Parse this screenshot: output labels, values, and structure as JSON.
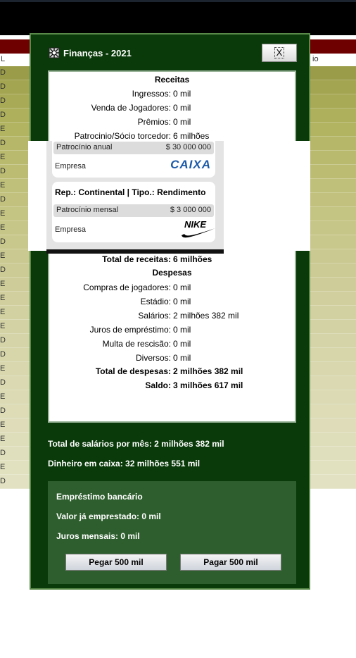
{
  "background": {
    "subheader": {
      "left": "L",
      "right": "io"
    },
    "row_markers": [
      "D",
      "D",
      "D",
      "D",
      "E",
      "D",
      "E",
      "D",
      "E",
      "D",
      "E",
      "E",
      "D",
      "E",
      "D",
      "E",
      "E",
      "E",
      "E",
      "D",
      "D",
      "E",
      "D",
      "E",
      "D",
      "E",
      "E",
      "D",
      "E",
      "D",
      "D",
      "E"
    ],
    "row_colors": [
      "#9a9c4a",
      "#a3a550",
      "#a9aa56",
      "#aeb05c",
      "#b2b462",
      "#b6b768",
      "#b9ba6e",
      "#bcbd73",
      "#bfc079",
      "#c2c27e",
      "#c4c483",
      "#c6c688",
      "#c8c88c",
      "#cac991",
      "#cccb95",
      "#cecd99",
      "#d0cf9d",
      "#d2d1a1",
      "#d3d2a5",
      "#d5d4a8",
      "#d7d6ab",
      "#d8d7ae",
      "#dad9b1",
      "#dbdab4",
      "#dddcb7",
      "#dedcb9",
      "#dfdebb",
      "#e0dfbd",
      "#e1e0bf",
      "#e2e1c1"
    ]
  },
  "dialog": {
    "title": "Finanças - 2021",
    "close_label": "X",
    "receitas_title": "Receitas",
    "receitas": [
      {
        "label": "Ingressos:",
        "value": "0 mil"
      },
      {
        "label": "Venda de Jogadores:",
        "value": "0 mil"
      },
      {
        "label": "Prêmios:",
        "value": "0 mil"
      },
      {
        "label": "Patrocinio/Sócio torcedor:",
        "value": "6 milhões"
      }
    ],
    "total_receitas": {
      "label": "Total de receitas:",
      "value": "6 milhões"
    },
    "despesas_title": "Despesas",
    "despesas": [
      {
        "label": "Compras de jogadores:",
        "value": "0 mil"
      },
      {
        "label": "Estádio:",
        "value": "0 mil"
      },
      {
        "label": "Salários:",
        "value": "2 milhões 382 mil"
      },
      {
        "label": "Juros de empréstimo:",
        "value": "0 mil"
      },
      {
        "label": "Multa de rescisão:",
        "value": "0 mil"
      },
      {
        "label": "Diversos:",
        "value": "0 mil"
      }
    ],
    "total_despesas": {
      "label": "Total de despesas:",
      "value": "2 milhões 382 mil"
    },
    "saldo": {
      "label": "Saldo:",
      "value": "3 milhões 617 mil"
    },
    "total_salarios": "Total de salários por mês: 2 milhões 382 mil",
    "dinheiro_caixa": "Dinheiro em caixa: 32 milhões 551 mil",
    "loan": {
      "title": "Empréstimo bancário",
      "ja_emprestado": "Valor já emprestado: 0 mil",
      "juros_mensais": "Juros mensais: 0 mil",
      "button_left": "Pegar 500 mil",
      "button_right": "Pagar 500 mil"
    }
  },
  "sponsors": {
    "card1": {
      "amount_label": "Patrocínio anual",
      "amount_value": "$ 30 000 000",
      "company_label": "Empresa",
      "brand": "CAIXA"
    },
    "card2": {
      "header": "Rep.: Continental | Tipo.: Rendimento",
      "amount_label": "Patrocínio mensal",
      "amount_value": "$ 3 000 000",
      "company_label": "Empresa",
      "brand": "NIKE"
    }
  },
  "colors": {
    "dialog_bg": "#0a3a0a",
    "loan_bg": "#2e5e2e",
    "header_red": "#6e0000",
    "caixa_blue": "#1b5aa8"
  }
}
